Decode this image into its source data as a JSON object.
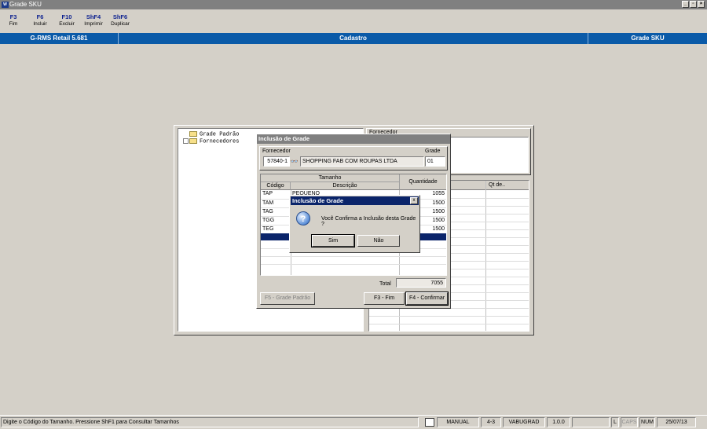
{
  "window": {
    "title": "Grade SKU"
  },
  "toolbar": [
    {
      "key": "F3",
      "label": "Fim"
    },
    {
      "key": "F6",
      "label": "Incluir"
    },
    {
      "key": "F10",
      "label": "Excluir"
    },
    {
      "key": "ShF4",
      "label": "Imprimir"
    },
    {
      "key": "ShF6",
      "label": "Duplicar"
    }
  ],
  "header": {
    "left": "G-RMS Retail 5.681",
    "center": "Cadastro",
    "right": "Grade SKU"
  },
  "tree": {
    "items": [
      "Grade Padrão",
      "Fornecedores"
    ]
  },
  "right_panel": {
    "label": "Fornecedor",
    "col_qt": "Qt de..",
    "col_partial": "o"
  },
  "inclusao": {
    "title": "Inclusão de Grade",
    "fornecedor_label": "Fornecedor",
    "fornecedor_code": "57840-1",
    "fornecedor_name": "SHOPPING FAB COM ROUPAS LTDA",
    "grade_label": "Grade",
    "grade_value": "01",
    "col_group": "Tamanho",
    "col_codigo": "Código",
    "col_descricao": "Descrição",
    "col_quantidade": "Quantidade",
    "rows": [
      {
        "codigo": "TAP",
        "descricao": "PEQUENO",
        "quantidade": "1055"
      },
      {
        "codigo": "TAM",
        "descricao": "",
        "quantidade": "1500"
      },
      {
        "codigo": "TAG",
        "descricao": "",
        "quantidade": "1500"
      },
      {
        "codigo": "TGG",
        "descricao": "",
        "quantidade": "1500"
      },
      {
        "codigo": "TEG",
        "descricao": "",
        "quantidade": "1500"
      }
    ],
    "total_label": "Total",
    "total_value": "7055",
    "btn_f5": "F5 - Grade Padrão",
    "btn_f3": "F3 - Fim",
    "btn_f4": "F4 - Confirmar"
  },
  "confirm": {
    "title": "Inclusão de Grade",
    "message": "Você Confirma a Inclusão desta Grade ?",
    "yes": "Sim",
    "no": "Não",
    "close": "x"
  },
  "statusbar": {
    "message": "Digite o Código do Tamanho. Pressione ShF1 para Consultar Tamanhos",
    "mode": "MANUAL",
    "version_a": "4-3",
    "program": "VABUGRAD",
    "version_b": "1.0.0",
    "l": "L",
    "caps": "CAPS",
    "num": "NUM",
    "date": "25/07/13"
  },
  "colors": {
    "header_blue": "#0a5aa8",
    "selection": "#0a246a",
    "dialog_title": "#0a246a"
  }
}
